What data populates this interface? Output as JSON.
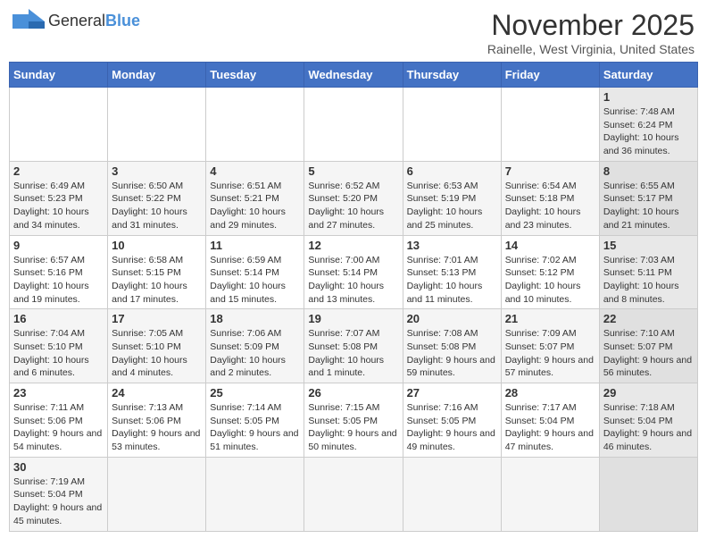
{
  "header": {
    "logo_general": "General",
    "logo_blue": "Blue",
    "month_title": "November 2025",
    "location": "Rainelle, West Virginia, United States"
  },
  "days_of_week": [
    "Sunday",
    "Monday",
    "Tuesday",
    "Wednesday",
    "Thursday",
    "Friday",
    "Saturday"
  ],
  "weeks": [
    [
      {
        "day": "",
        "info": ""
      },
      {
        "day": "",
        "info": ""
      },
      {
        "day": "",
        "info": ""
      },
      {
        "day": "",
        "info": ""
      },
      {
        "day": "",
        "info": ""
      },
      {
        "day": "",
        "info": ""
      },
      {
        "day": "1",
        "info": "Sunrise: 7:48 AM\nSunset: 6:24 PM\nDaylight: 10 hours and 36 minutes."
      }
    ],
    [
      {
        "day": "2",
        "info": "Sunrise: 6:49 AM\nSunset: 5:23 PM\nDaylight: 10 hours and 34 minutes."
      },
      {
        "day": "3",
        "info": "Sunrise: 6:50 AM\nSunset: 5:22 PM\nDaylight: 10 hours and 31 minutes."
      },
      {
        "day": "4",
        "info": "Sunrise: 6:51 AM\nSunset: 5:21 PM\nDaylight: 10 hours and 29 minutes."
      },
      {
        "day": "5",
        "info": "Sunrise: 6:52 AM\nSunset: 5:20 PM\nDaylight: 10 hours and 27 minutes."
      },
      {
        "day": "6",
        "info": "Sunrise: 6:53 AM\nSunset: 5:19 PM\nDaylight: 10 hours and 25 minutes."
      },
      {
        "day": "7",
        "info": "Sunrise: 6:54 AM\nSunset: 5:18 PM\nDaylight: 10 hours and 23 minutes."
      },
      {
        "day": "8",
        "info": "Sunrise: 6:55 AM\nSunset: 5:17 PM\nDaylight: 10 hours and 21 minutes."
      }
    ],
    [
      {
        "day": "9",
        "info": "Sunrise: 6:57 AM\nSunset: 5:16 PM\nDaylight: 10 hours and 19 minutes."
      },
      {
        "day": "10",
        "info": "Sunrise: 6:58 AM\nSunset: 5:15 PM\nDaylight: 10 hours and 17 minutes."
      },
      {
        "day": "11",
        "info": "Sunrise: 6:59 AM\nSunset: 5:14 PM\nDaylight: 10 hours and 15 minutes."
      },
      {
        "day": "12",
        "info": "Sunrise: 7:00 AM\nSunset: 5:14 PM\nDaylight: 10 hours and 13 minutes."
      },
      {
        "day": "13",
        "info": "Sunrise: 7:01 AM\nSunset: 5:13 PM\nDaylight: 10 hours and 11 minutes."
      },
      {
        "day": "14",
        "info": "Sunrise: 7:02 AM\nSunset: 5:12 PM\nDaylight: 10 hours and 10 minutes."
      },
      {
        "day": "15",
        "info": "Sunrise: 7:03 AM\nSunset: 5:11 PM\nDaylight: 10 hours and 8 minutes."
      }
    ],
    [
      {
        "day": "16",
        "info": "Sunrise: 7:04 AM\nSunset: 5:10 PM\nDaylight: 10 hours and 6 minutes."
      },
      {
        "day": "17",
        "info": "Sunrise: 7:05 AM\nSunset: 5:10 PM\nDaylight: 10 hours and 4 minutes."
      },
      {
        "day": "18",
        "info": "Sunrise: 7:06 AM\nSunset: 5:09 PM\nDaylight: 10 hours and 2 minutes."
      },
      {
        "day": "19",
        "info": "Sunrise: 7:07 AM\nSunset: 5:08 PM\nDaylight: 10 hours and 1 minute."
      },
      {
        "day": "20",
        "info": "Sunrise: 7:08 AM\nSunset: 5:08 PM\nDaylight: 9 hours and 59 minutes."
      },
      {
        "day": "21",
        "info": "Sunrise: 7:09 AM\nSunset: 5:07 PM\nDaylight: 9 hours and 57 minutes."
      },
      {
        "day": "22",
        "info": "Sunrise: 7:10 AM\nSunset: 5:07 PM\nDaylight: 9 hours and 56 minutes."
      }
    ],
    [
      {
        "day": "23",
        "info": "Sunrise: 7:11 AM\nSunset: 5:06 PM\nDaylight: 9 hours and 54 minutes."
      },
      {
        "day": "24",
        "info": "Sunrise: 7:13 AM\nSunset: 5:06 PM\nDaylight: 9 hours and 53 minutes."
      },
      {
        "day": "25",
        "info": "Sunrise: 7:14 AM\nSunset: 5:05 PM\nDaylight: 9 hours and 51 minutes."
      },
      {
        "day": "26",
        "info": "Sunrise: 7:15 AM\nSunset: 5:05 PM\nDaylight: 9 hours and 50 minutes."
      },
      {
        "day": "27",
        "info": "Sunrise: 7:16 AM\nSunset: 5:05 PM\nDaylight: 9 hours and 49 minutes."
      },
      {
        "day": "28",
        "info": "Sunrise: 7:17 AM\nSunset: 5:04 PM\nDaylight: 9 hours and 47 minutes."
      },
      {
        "day": "29",
        "info": "Sunrise: 7:18 AM\nSunset: 5:04 PM\nDaylight: 9 hours and 46 minutes."
      }
    ],
    [
      {
        "day": "30",
        "info": "Sunrise: 7:19 AM\nSunset: 5:04 PM\nDaylight: 9 hours and 45 minutes."
      },
      {
        "day": "",
        "info": ""
      },
      {
        "day": "",
        "info": ""
      },
      {
        "day": "",
        "info": ""
      },
      {
        "day": "",
        "info": ""
      },
      {
        "day": "",
        "info": ""
      },
      {
        "day": "",
        "info": ""
      }
    ]
  ]
}
